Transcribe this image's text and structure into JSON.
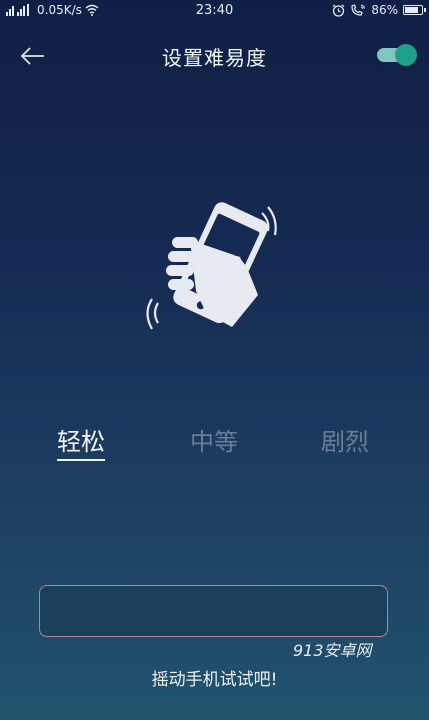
{
  "status_bar": {
    "network_speed": "0.05K/s",
    "time": "23:40",
    "battery": "86%",
    "battery_level": 0.86,
    "icons": [
      "signal-icon",
      "wifi-icon",
      "alarm-icon",
      "call-icon",
      "battery-icon"
    ]
  },
  "header": {
    "title": "设置难易度",
    "back_icon": "back-arrow-icon",
    "toggle_on": true
  },
  "colors": {
    "toggle_knob": "#1fa189",
    "toggle_track": "#7fc6c0",
    "tab_active": "#f4f6fa",
    "tab_inactive": "#6a7d98",
    "result_border": "#b08a8e"
  },
  "illustration": {
    "icon": "shake-phone-icon"
  },
  "difficulty": {
    "tabs": [
      {
        "label": "轻松",
        "selected": true
      },
      {
        "label": "中等",
        "selected": false
      },
      {
        "label": "剧烈",
        "selected": false
      }
    ]
  },
  "result_box": {
    "value": ""
  },
  "watermark": "913安卓网",
  "hint": "摇动手机试试吧!"
}
